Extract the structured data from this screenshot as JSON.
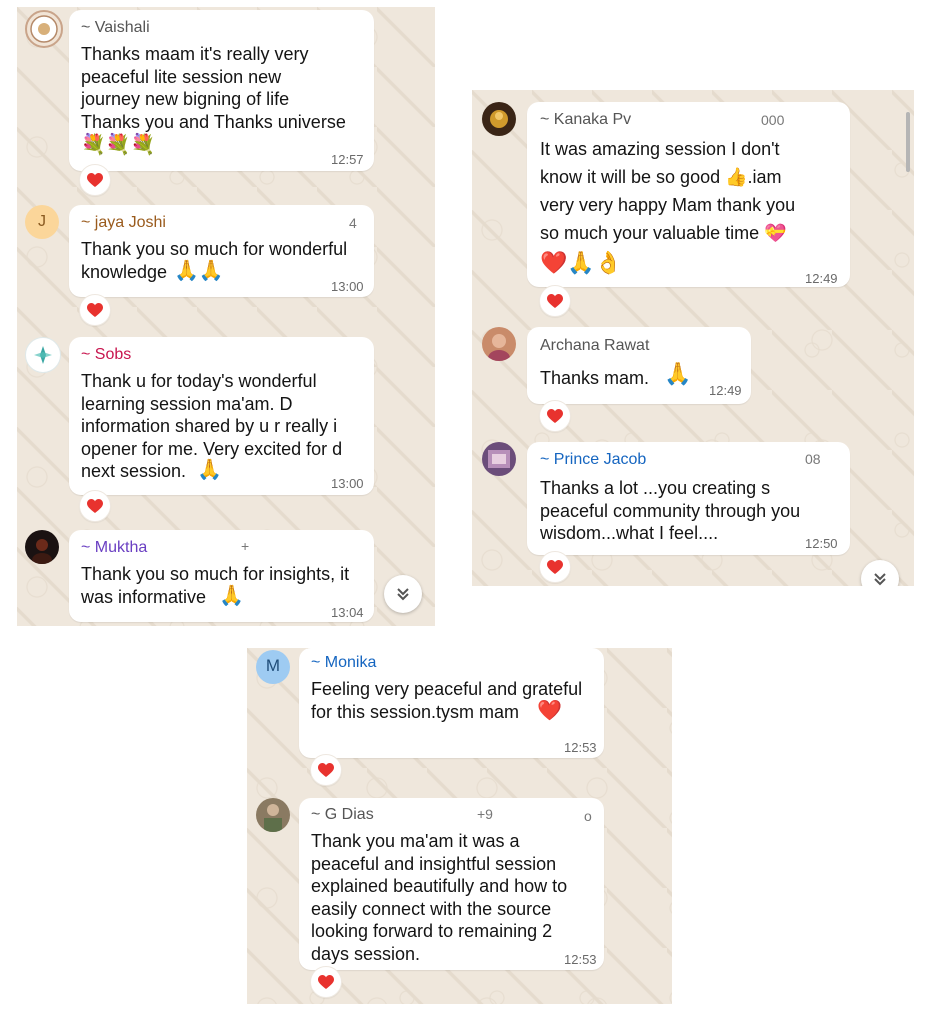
{
  "colors": {
    "chat_bg": "#efe7dc",
    "bubble": "#ffffff",
    "heart": "#e8322e",
    "timestamp": "#6a6a6a"
  },
  "panel1": {
    "messages": [
      {
        "sender": "~ Vaishali",
        "sender_color": "#555555",
        "text": "Thanks  maam  it's really very\npeaceful   lite session  new\njourney  new bigning of life\nThanks  you and Thanks  universe",
        "emoji": "💐💐💐",
        "time": "12:57",
        "reaction": "heart-icon"
      },
      {
        "sender": "~ jaya Joshi",
        "sender_color": "#9a5b1d",
        "phone": "4",
        "avatar_letter": "J",
        "text": "Thank you so much for wonderful\nknowledge",
        "emoji": "🙏🙏",
        "time": "13:00",
        "reaction": "heart-icon"
      },
      {
        "sender": "~ Sobs",
        "sender_color": "#c8154e",
        "text": "Thank u for today's wonderful\nlearning session ma'am. D\ninformation shared by u r really i\nopener for me. Very excited for d\nnext session.",
        "emoji": "🙏",
        "time": "13:00",
        "reaction": "heart-icon"
      },
      {
        "sender": "~ Muktha",
        "sender_color": "#6a3fc2",
        "phone": "+",
        "text": "Thank you so much for insights, it\nwas informative",
        "emoji": "🙏",
        "time": "13:04"
      }
    ]
  },
  "panel2": {
    "messages": [
      {
        "sender": "~ Kanaka Pv",
        "sender_color": "#555555",
        "phone": "000",
        "text": "It was amazing session I don't\nknow it will be so good 👍.iam\nvery very happy Mam thank you\nso much your valuable time 💝",
        "emoji": "❤️🙏👌",
        "time": "12:49",
        "reaction": "heart-icon"
      },
      {
        "sender": "Archana Rawat",
        "sender_color": "#555555",
        "text": "Thanks mam.",
        "emoji": "🙏",
        "time": "12:49",
        "reaction": "heart-icon"
      },
      {
        "sender": "~ Prince Jacob",
        "sender_color": "#1565c0",
        "phone": "08",
        "text": "Thanks a lot ...you creating s\npeaceful community through you\nwisdom...what I feel....",
        "time": "12:50",
        "reaction": "heart-icon"
      }
    ]
  },
  "panel3": {
    "messages": [
      {
        "sender": "~ Monika",
        "sender_color": "#1565c0",
        "avatar_letter": "M",
        "text": "Feeling very peaceful and grateful\nfor this session.tysm mam",
        "emoji": "❤️",
        "time": "12:53",
        "reaction": "heart-icon"
      },
      {
        "sender": "~ G Dias",
        "sender_color": "#555555",
        "phone": "+9",
        "phone_end": "o",
        "text": "Thank you ma'am it was a\npeaceful and insightful session\nexplained beautifully and how to\neasily connect with the source\nlooking forward to remaining 2\ndays session.",
        "time": "12:53",
        "reaction": "heart-icon"
      }
    ]
  }
}
